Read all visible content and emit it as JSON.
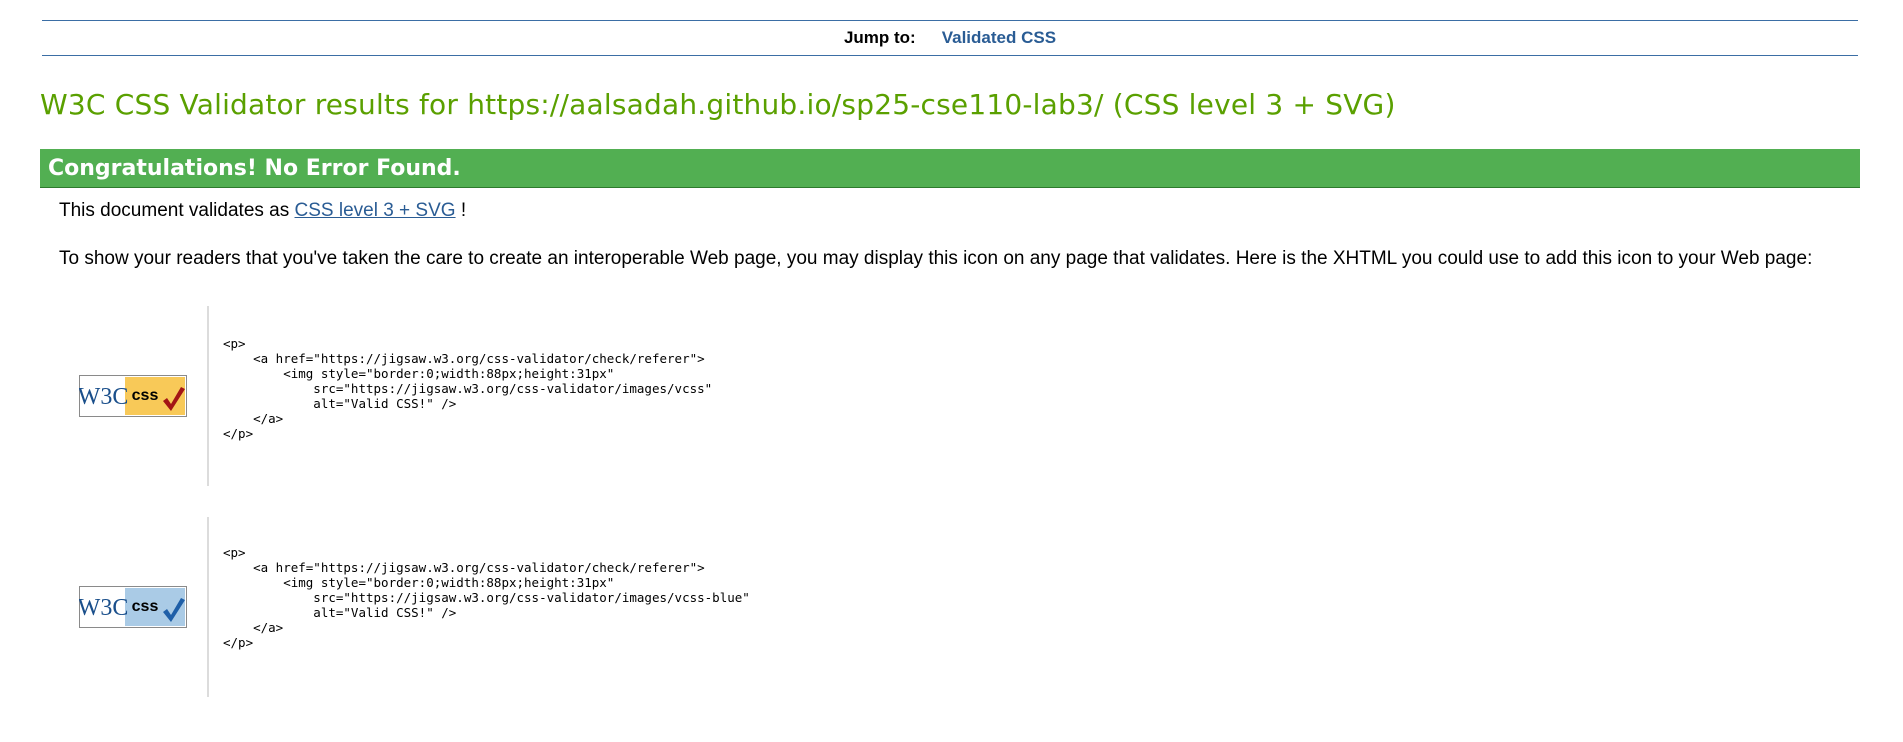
{
  "nav": {
    "jump_label": "Jump to:",
    "jump_link": "Validated CSS"
  },
  "title": "W3C CSS Validator results for https://aalsadah.github.io/sp25-cse110-lab3/ (CSS level 3 + SVG)",
  "banner": "Congratulations! No Error Found.",
  "validates": {
    "prefix": "This document validates as",
    "link": "CSS level 3 + SVG",
    "suffix": "!"
  },
  "explain": "To show your readers that you've taken the care to create an interoperable Web page, you may display this icon on any page that validates. Here is the XHTML you could use to add this icon to your Web page:",
  "badges": [
    {
      "logo": "W3C",
      "label": "css",
      "variant": "gold",
      "icon": "w3c-css-gold-badge"
    },
    {
      "logo": "W3C",
      "label": "css",
      "variant": "blue",
      "icon": "w3c-css-blue-badge"
    }
  ],
  "snippets": [
    "<p>\n    <a href=\"https://jigsaw.w3.org/css-validator/check/referer\">\n        <img style=\"border:0;width:88px;height:31px\"\n            src=\"https://jigsaw.w3.org/css-validator/images/vcss\"\n            alt=\"Valid CSS!\" />\n    </a>\n</p>",
    "<p>\n    <a href=\"https://jigsaw.w3.org/css-validator/check/referer\">\n        <img style=\"border:0;width:88px;height:31px\"\n            src=\"https://jigsaw.w3.org/css-validator/images/vcss-blue\"\n            alt=\"Valid CSS!\" />\n    </a>\n</p>"
  ],
  "colors": {
    "title": "#5aa000",
    "banner": "#52af52",
    "link": "#2a5c94",
    "gold": "#f8c958",
    "blue": "#aacbe6"
  }
}
